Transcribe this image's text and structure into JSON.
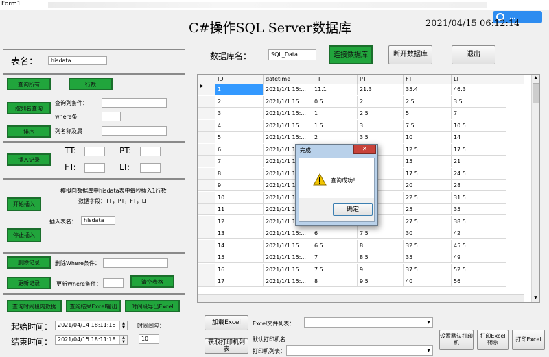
{
  "window": {
    "title": "Form1"
  },
  "watermark": {
    "text": "…"
  },
  "header": {
    "title": "C#操作SQL Server数据库",
    "datetime": "2021/04/15 06:12:14"
  },
  "table_name": {
    "label": "表名：",
    "value": "hisdata"
  },
  "db": {
    "label": "数据库名：",
    "value": "SQL_Data",
    "connect": "连接数据库",
    "disconnect": "断开数据库",
    "exit": "退出"
  },
  "query": {
    "query_all": "查询所有",
    "count": "行数",
    "by_column": "按列名查询",
    "where_column_label": "查询列条件：",
    "where_label": "where条",
    "sort": "排序",
    "sort_name_label": "列名称及属"
  },
  "insert": {
    "button": "插入记录",
    "tt": "TT:",
    "pt": "PT:",
    "ft": "FT:",
    "lt": "LT:"
  },
  "simulate": {
    "desc1": "模拟向数据库中hisdata表中每秒插入1行数",
    "desc2": "数据字段：TT，PT，FT，LT",
    "start": "开始插入",
    "stop": "停止插入",
    "table_label": "插入表名：",
    "table_value": "hisdata"
  },
  "modify": {
    "delete": "删除记录",
    "delete_where": "删除Where条件：",
    "update": "更新记录",
    "update_where": "更新Where条件：",
    "clear": "清空表格"
  },
  "export": {
    "by_time": "查询时间段内数据",
    "to_excel": "查询结果Excel输出",
    "by_time_excel": "时间段导出Excel"
  },
  "time": {
    "start_label": "起始时间：",
    "start_value": "2021/04/14 18:11:18",
    "end_label": "结束时间：",
    "end_value": "2021/04/15 18:11:18",
    "interval_label": "时间间隔：",
    "interval_value": "10"
  },
  "bottom": {
    "load_excel": "加载Excel",
    "excel_list": "Excel文件列表：",
    "get_printers": "获取打印机列表",
    "default_printer": "默认打印机名",
    "printer_list": "打印机列表：",
    "set_default": "设置默认打印机",
    "preview": "打印Excel预览",
    "print": "打印Excel"
  },
  "grid": {
    "columns": [
      "ID",
      "datetime",
      "TT",
      "PT",
      "FT",
      "LT"
    ],
    "rows": [
      [
        "1",
        "2021/1/1 15:...",
        "11.1",
        "21.3",
        "35.4",
        "46.3"
      ],
      [
        "2",
        "2021/1/1 15:...",
        "0.5",
        "2",
        "2.5",
        "3.5"
      ],
      [
        "3",
        "2021/1/1 15:...",
        "1",
        "2.5",
        "5",
        "7"
      ],
      [
        "4",
        "2021/1/1 15:...",
        "1.5",
        "3",
        "7.5",
        "10.5"
      ],
      [
        "5",
        "2021/1/1 15:...",
        "2",
        "3.5",
        "10",
        "14"
      ],
      [
        "6",
        "2021/1/1 15:...",
        "",
        "",
        "12.5",
        "17.5"
      ],
      [
        "7",
        "2021/1/1 15:...",
        "",
        "",
        "15",
        "21"
      ],
      [
        "8",
        "2021/1/1 15:...",
        "",
        "",
        "17.5",
        "24.5"
      ],
      [
        "9",
        "2021/1/1 15:...",
        "",
        "",
        "20",
        "28"
      ],
      [
        "10",
        "2021/1/1 15:...",
        "",
        "",
        "22.5",
        "31.5"
      ],
      [
        "11",
        "2021/1/1 15:...",
        "",
        "",
        "25",
        "35"
      ],
      [
        "12",
        "2021/1/1 15:...",
        "",
        "",
        "27.5",
        "38.5"
      ],
      [
        "13",
        "2021/1/1 15:...",
        "6",
        "7.5",
        "30",
        "42"
      ],
      [
        "14",
        "2021/1/1 15:...",
        "6.5",
        "8",
        "32.5",
        "45.5"
      ],
      [
        "15",
        "2021/1/1 15:...",
        "7",
        "8.5",
        "35",
        "49"
      ],
      [
        "16",
        "2021/1/1 15:...",
        "7.5",
        "9",
        "37.5",
        "52.5"
      ],
      [
        "17",
        "2021/1/1 15:...",
        "8",
        "9.5",
        "40",
        "56"
      ]
    ]
  },
  "dialog": {
    "title": "完成",
    "message": "查询成功！",
    "ok": "确定",
    "close": "✕"
  }
}
